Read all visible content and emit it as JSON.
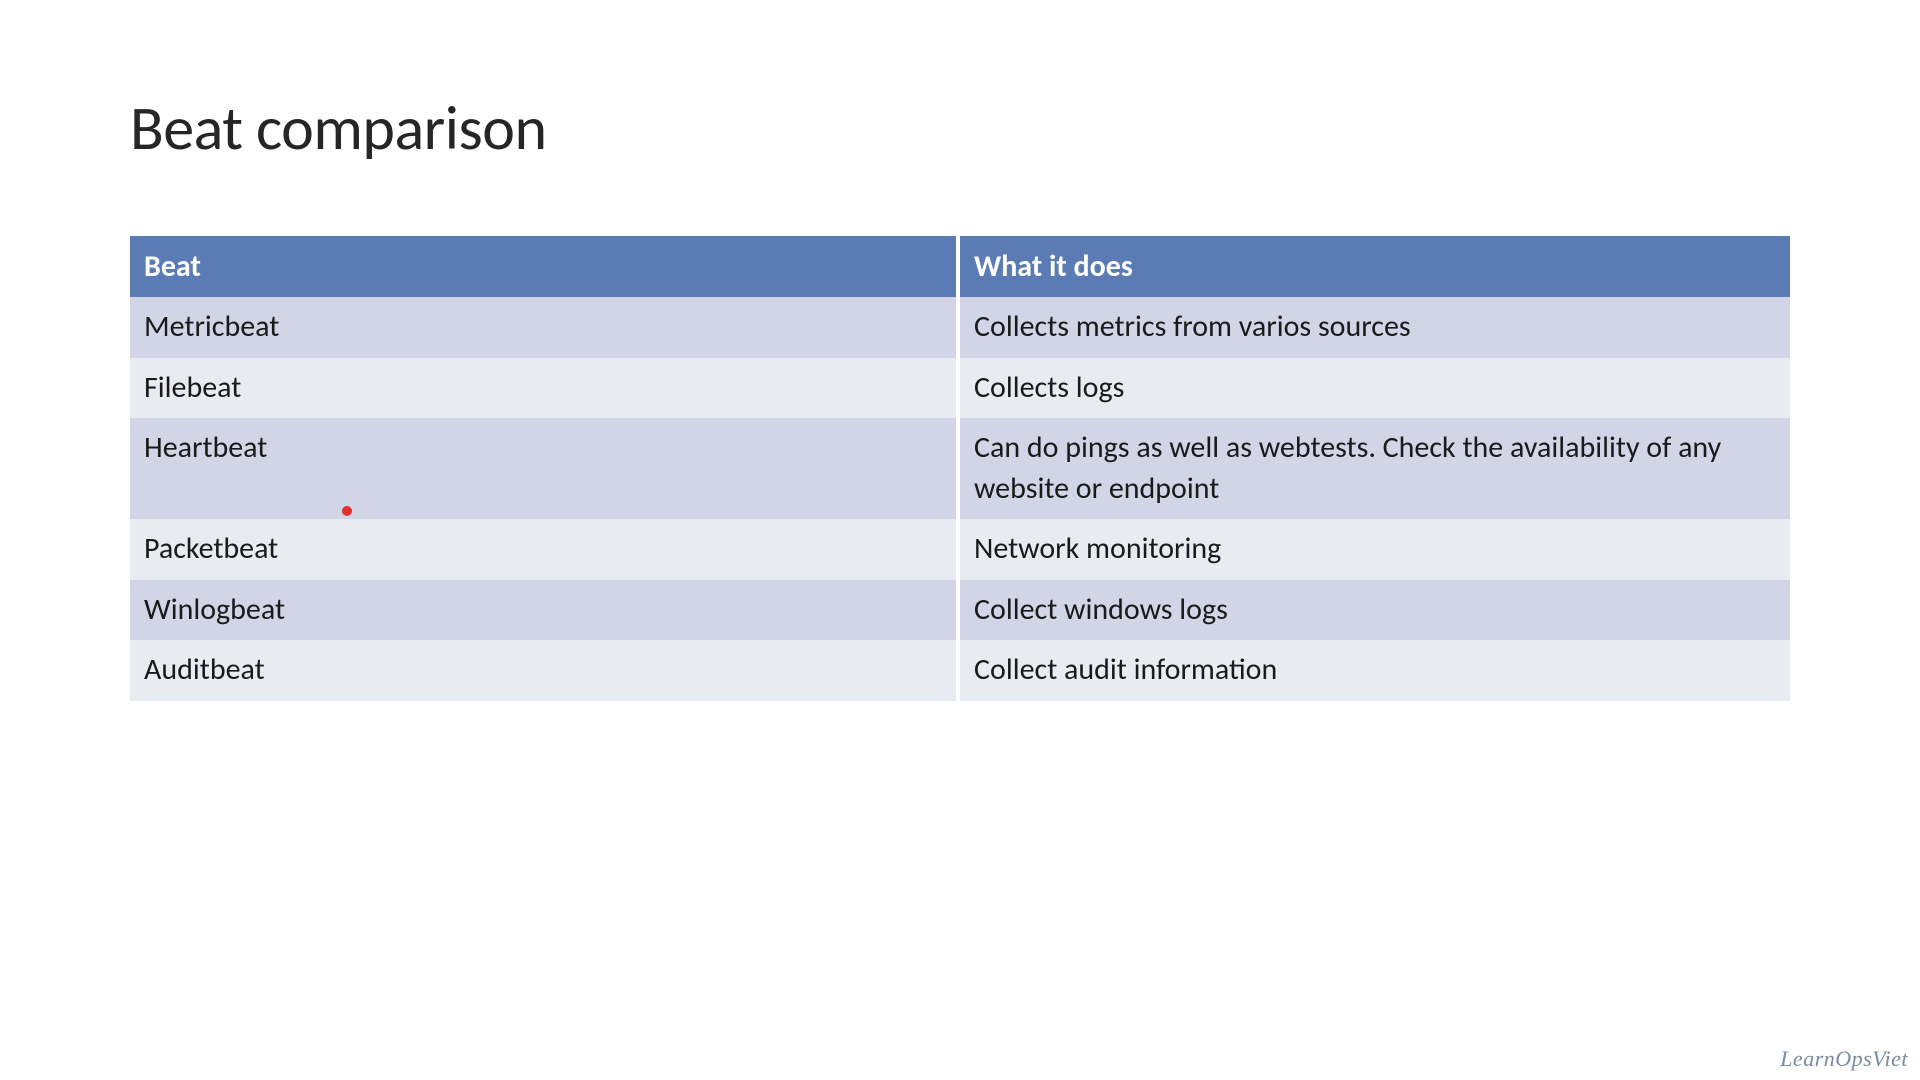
{
  "slide": {
    "title": "Beat comparison"
  },
  "table": {
    "headers": {
      "beat": "Beat",
      "desc": "What it does"
    },
    "rows": [
      {
        "beat": "Metricbeat",
        "desc": "Collects metrics from varios sources"
      },
      {
        "beat": "Filebeat",
        "desc": "Collects logs"
      },
      {
        "beat": "Heartbeat",
        "desc": "Can do pings as well as webtests. Check the availability of any website or endpoint"
      },
      {
        "beat": "Packetbeat",
        "desc": "Network monitoring"
      },
      {
        "beat": "Winlogbeat",
        "desc": "Collect windows logs"
      },
      {
        "beat": "Auditbeat",
        "desc": "Collect audit information"
      }
    ]
  },
  "watermark": "LearnOpsViet"
}
